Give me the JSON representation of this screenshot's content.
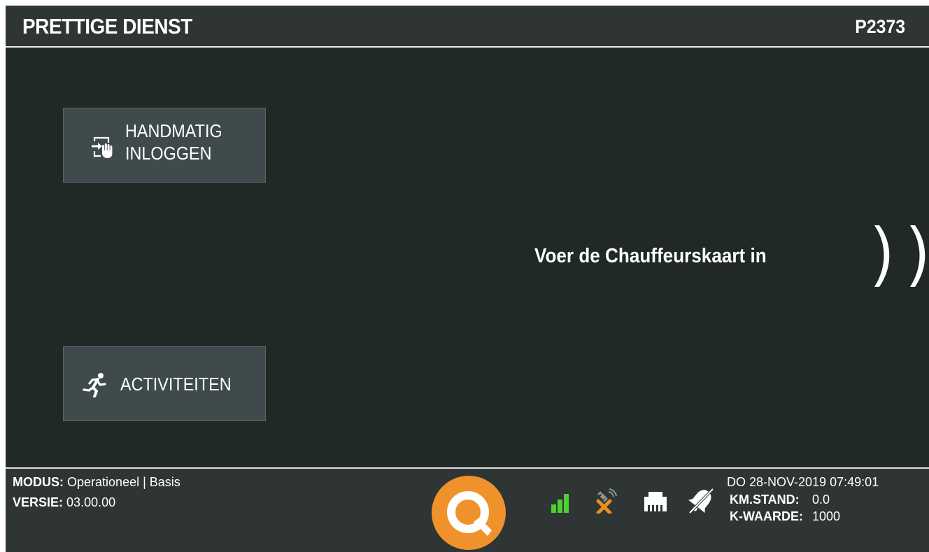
{
  "header": {
    "title": "PRETTIGE DIENST",
    "vehicle_id": "P2373"
  },
  "buttons": {
    "manual_login": {
      "line1": "HANDMATIG",
      "line2": "INLOGGEN",
      "icon": "login-hand-icon"
    },
    "activities": {
      "label": "ACTIVITEITEN",
      "icon": "running-person-icon"
    }
  },
  "main": {
    "prompt": "Voer de Chauffeurskaart in",
    "next_icon": "double-chevron-right-icon"
  },
  "footer": {
    "modus_label": "MODUS:",
    "modus_value": "Operationeel | Basis",
    "versie_label": "VERSIE:",
    "versie_value": "03.00.00",
    "datetime": "DO 28-NOV-2019 07:49:01",
    "km_label": "KM.STAND:",
    "km_value": "0.0",
    "k_label": "K-WAARDE:",
    "k_value": "1000",
    "status_icons": [
      "signal-strength-icon",
      "gps-disconnected-icon",
      "network-port-icon",
      "bell-muted-icon"
    ]
  },
  "colors": {
    "background": "#202926",
    "bar": "#2e3534",
    "button": "#3f4a4c",
    "logo_orange": "#f0922b",
    "signal_green": "#4cd12f",
    "gps_warning": "#e8911c"
  }
}
